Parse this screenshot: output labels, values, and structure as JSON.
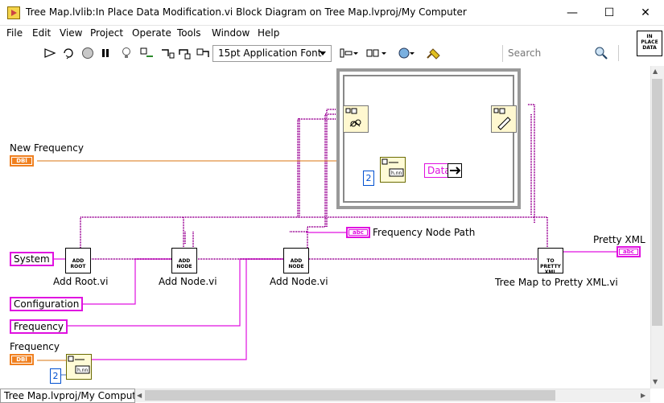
{
  "window": {
    "title": "Tree Map.lvlib:In Place Data Modification.vi Block Diagram on Tree Map.lvproj/My Computer",
    "minimize": "—",
    "maximize": "☐",
    "close": "✕"
  },
  "menu": [
    "File",
    "Edit",
    "View",
    "Project",
    "Operate",
    "Tools",
    "Window",
    "Help"
  ],
  "toolbar": {
    "font_label": "15pt Application Font",
    "search_placeholder": "Search",
    "vi_icon_text": "IN PLACE DATA"
  },
  "diagram": {
    "new_frequency_label": "New Frequency",
    "dbl_text": "DBl",
    "abc_text": "abc",
    "frequency_node_path_label": "Frequency Node Path",
    "pretty_xml_label": "Pretty XML",
    "system_const": "System",
    "configuration_const": "Configuration",
    "frequency_const": "Frequency",
    "frequency_label": "Frequency",
    "add_root_text": "ADD ROOT",
    "add_root_label": "Add Root.vi",
    "add_node_text": "ADD NODE",
    "add_node_label_1": "Add Node.vi",
    "add_node_label_2": "Add Node.vi",
    "to_pretty_text": "TO PRETTY XML",
    "tree_map_pretty_label": "Tree Map to Pretty XML.vi",
    "num_const_1": "2",
    "num_const_2": "2",
    "data_label": "Data"
  },
  "status": {
    "path": "Tree Map.lvproj/My Computer"
  },
  "colors": {
    "wire_string": "#e010e0",
    "wire_dbl": "#f08020",
    "wire_class": "#a0109a"
  }
}
